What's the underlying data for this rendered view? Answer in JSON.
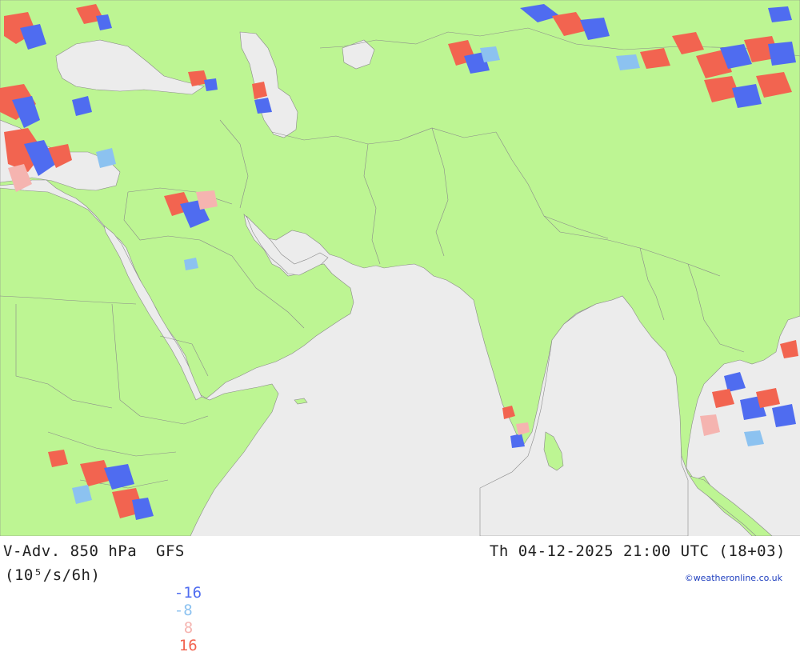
{
  "map": {
    "ocean_color": "#ececec",
    "land_color": "#bdf593",
    "border_color": "#8a8a8a",
    "advection_colors": {
      "strong_negative": "#4f6cf0",
      "weak_negative": "#8cc2f0",
      "weak_positive": "#f5b4b0",
      "strong_positive": "#f26450"
    }
  },
  "footer": {
    "title": "V-Adv. 850 hPa  GFS",
    "datetime": "Th 04-12-2025 21:00 UTC (18+03)",
    "units": "(10⁵/s/6h)",
    "legend": [
      {
        "label": "-16",
        "color": "#4f6cf0"
      },
      {
        "label": "-8",
        "color": "#8cc2f0"
      },
      {
        "label": "8",
        "color": "#f5b4b0"
      },
      {
        "label": "16",
        "color": "#f26450"
      }
    ],
    "credit": "©weatheronline.co.uk"
  }
}
